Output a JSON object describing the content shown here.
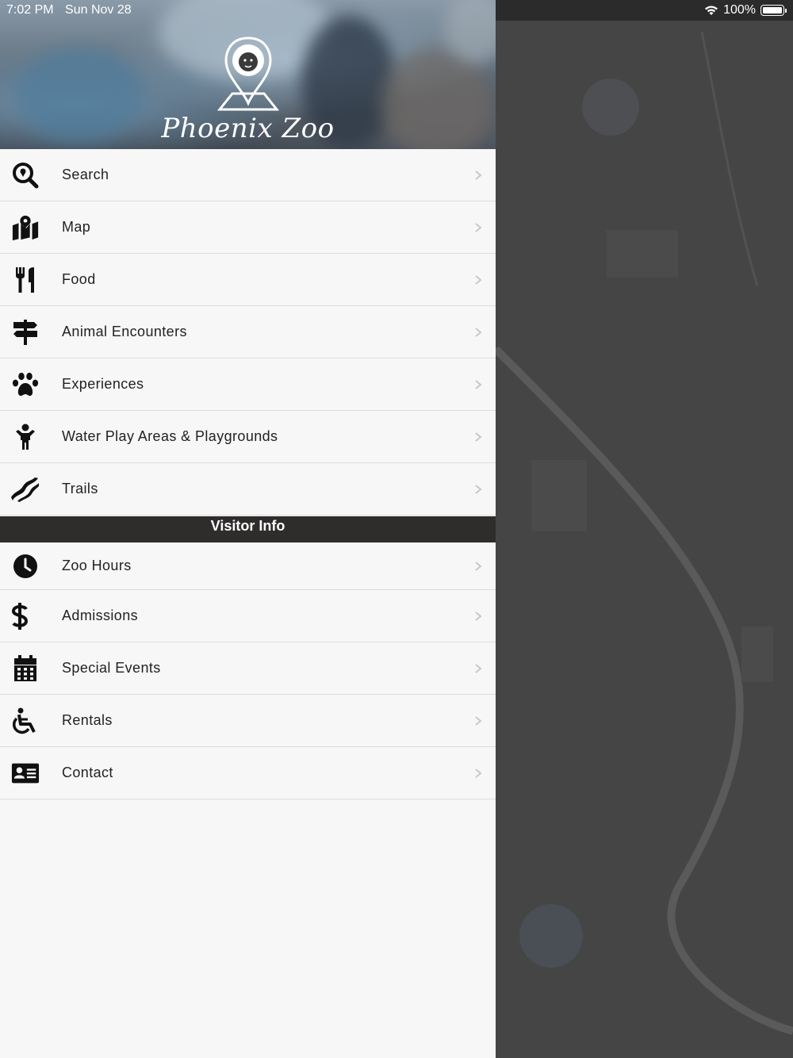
{
  "status_bar": {
    "time": "7:02 PM",
    "date": "Sun Nov 28",
    "battery": "100%"
  },
  "header": {
    "logo_text": "Phoenix Zoo",
    "icon": "lion-pin-logo"
  },
  "menu": {
    "items": [
      {
        "label": "Search",
        "icon": "search-location-icon"
      },
      {
        "label": "Map",
        "icon": "map-marked-icon"
      },
      {
        "label": "Food",
        "icon": "utensils-icon"
      },
      {
        "label": "Animal Encounters",
        "icon": "signpost-icon"
      },
      {
        "label": "Experiences",
        "icon": "paw-icon"
      },
      {
        "label": "Water Play Areas & Playgrounds",
        "icon": "child-icon"
      },
      {
        "label": "Trails",
        "icon": "trail-icon"
      }
    ]
  },
  "visitor_info": {
    "title": "Visitor Info",
    "items": [
      {
        "label": "Zoo Hours",
        "icon": "clock-icon"
      },
      {
        "label": "Admissions",
        "icon": "dollar-icon"
      },
      {
        "label": "Special Events",
        "icon": "calendar-icon"
      },
      {
        "label": "Rentals",
        "icon": "wheelchair-icon"
      },
      {
        "label": "Contact",
        "icon": "id-card-icon"
      }
    ]
  },
  "colors": {
    "section_bg": "#2f2c2c",
    "drawer_bg": "#f7f7f7",
    "overlay": "#454545"
  }
}
